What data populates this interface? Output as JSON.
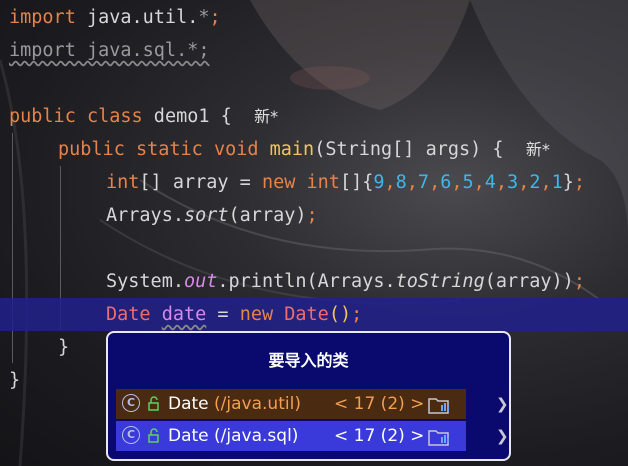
{
  "code": {
    "line1": {
      "kw": "import",
      "rest": " java.util.",
      "star": "*",
      "semi": ";"
    },
    "line2": {
      "text": "import java.sql.*;"
    },
    "line4": {
      "kw1": "public",
      "kw2": "class",
      "name": " demo1 {",
      "hint": "新*"
    },
    "line5": {
      "kw1": "public",
      "kw2": "static",
      "kw3": "void",
      "fn": "main",
      "rest": "(String[] args) {",
      "hint": "新*"
    },
    "line6": {
      "kw1": "int",
      "mid1": "[] array = ",
      "kw2": "new",
      "kw3": "int",
      "mid2": "[]{",
      "nums": [
        "9",
        "8",
        "7",
        "6",
        "5",
        "4",
        "3",
        "2",
        "1"
      ],
      "close": "}",
      "semi": ";"
    },
    "line7": {
      "pre": "Arrays.",
      "it": "sort",
      "post": "(array)",
      "semi": ";"
    },
    "line9": {
      "pre": "System.",
      "fld": "out",
      "mid": ".println(Arrays.",
      "it": "toString",
      "post": "(array))",
      "semi": ";"
    },
    "line10": {
      "err1": "Date",
      "var": "date",
      "eq": " = ",
      "kw": "new",
      "err2": "Date",
      "parens": "()",
      "semi": ";"
    },
    "line11": {
      "text": "}"
    },
    "line12": {
      "text": "}"
    }
  },
  "popup": {
    "title": "要导入的类",
    "items": [
      {
        "icon": "C",
        "label": "Date ",
        "package": "(/java.util)",
        "version": "< 17 (2) >"
      },
      {
        "icon": "C",
        "label": "Date ",
        "package": "(/java.sql)",
        "version": "< 17 (2) >"
      }
    ]
  },
  "colors": {
    "keyword": "#e5834a",
    "number": "#3fb6e8",
    "method": "#f2c55c",
    "selection": "#3a3adb"
  }
}
